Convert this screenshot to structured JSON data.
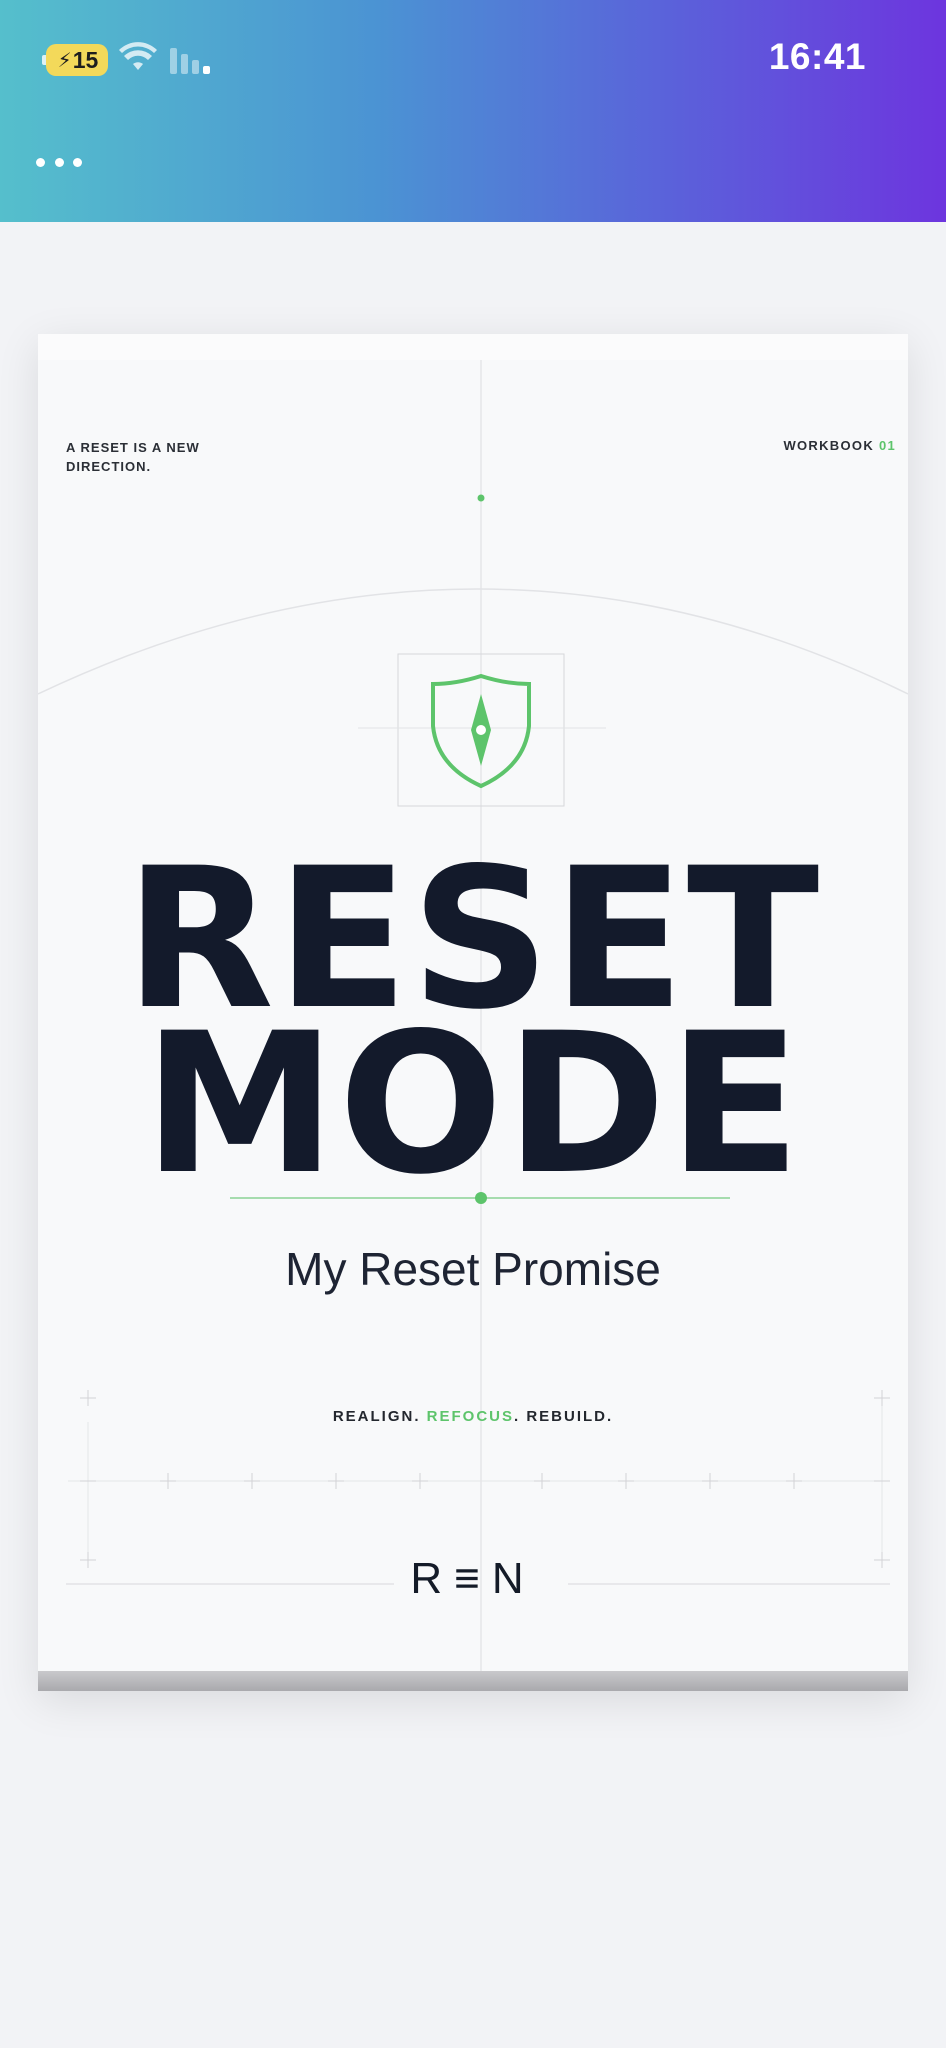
{
  "status_bar": {
    "battery_level": "15",
    "time": "16:41"
  },
  "header": {
    "more_icon": "ellipsis-icon"
  },
  "cover": {
    "tagline": "A RESET IS A NEW DIRECTION.",
    "workbook_label": "WORKBOOK",
    "workbook_number": "01",
    "title_line_1": "RESET",
    "title_line_2": "MODE",
    "subtitle": "My Reset Promise",
    "motto": {
      "part_1": "REALIGN.",
      "part_2": "REFOCUS",
      "part_3": ". REBUILD."
    },
    "brand": "R≡N",
    "emblem_icon": "shield-compass-icon",
    "accent_color": "#5dc46b",
    "title_color": "#131a2b"
  }
}
